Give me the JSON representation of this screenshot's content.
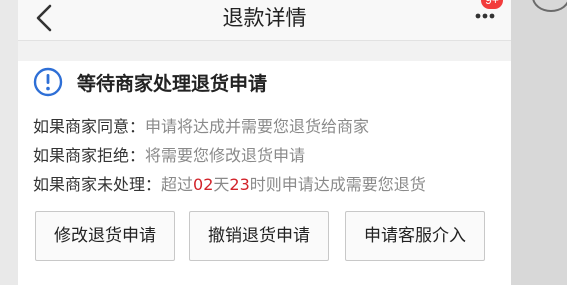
{
  "header": {
    "title": "退款详情",
    "back_icon": "chevron-left-icon",
    "more_icon": "ellipsis-icon",
    "message_badge": "9+"
  },
  "status": {
    "icon": "exclamation-circle-icon",
    "title": "等待商家处理退货申请",
    "accent_color": "#2e6fd6"
  },
  "info": {
    "agree": {
      "label": "如果商家同意：",
      "value": "申请将达成并需要您退货给商家"
    },
    "refuse": {
      "label": "如果商家拒绝：",
      "value": "将需要您修改退货申请"
    },
    "unhandled": {
      "label": "如果商家未处理：",
      "prefix": "超过",
      "days": "02",
      "day_unit": "天",
      "hours": "23",
      "suffix": "时则申请达成需要您退货",
      "highlight_color": "#d2232a"
    }
  },
  "actions": {
    "modify": "修改退货申请",
    "cancel": "撤销退货申请",
    "service": "申请客服介入"
  }
}
